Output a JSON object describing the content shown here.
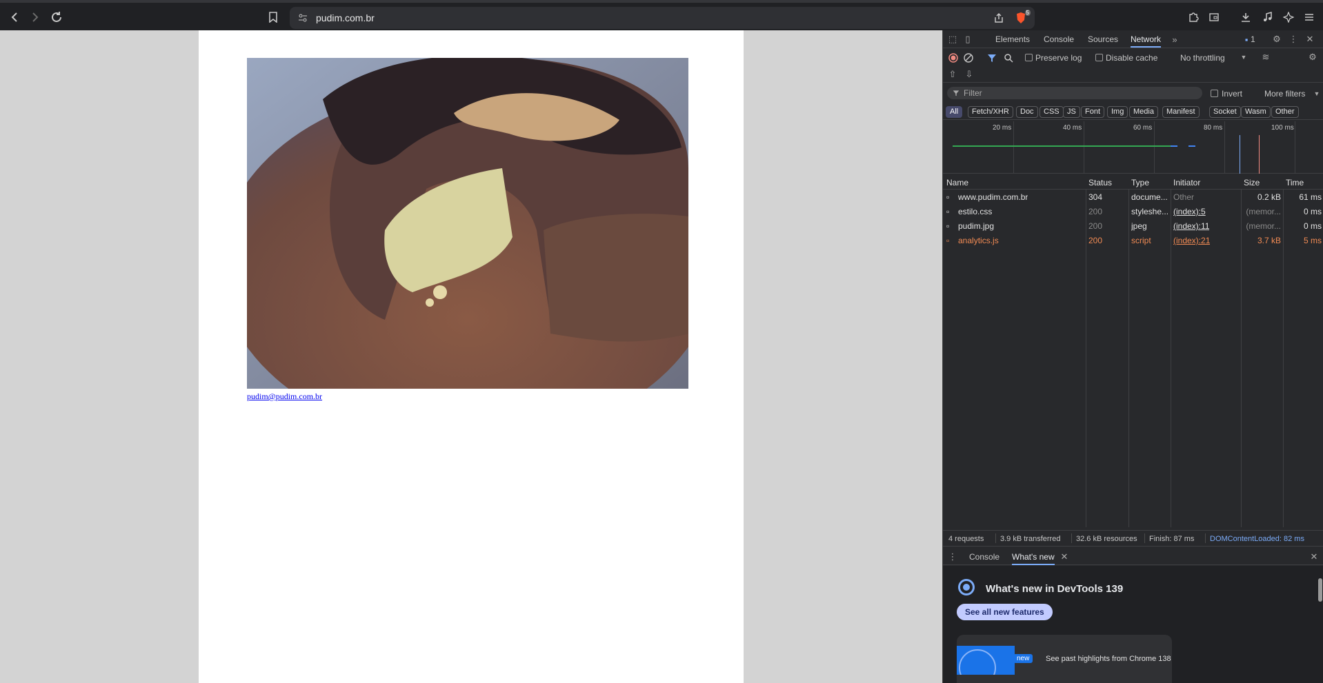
{
  "browser": {
    "url": "pudim.com.br",
    "shield_badge": "5"
  },
  "page": {
    "email": "pudim@pudim.com.br"
  },
  "devtools": {
    "tabs": [
      "Elements",
      "Console",
      "Sources",
      "Network"
    ],
    "active_tab": "Network",
    "issues_count": "1",
    "toolbar": {
      "preserve_log": "Preserve log",
      "disable_cache": "Disable cache",
      "throttling": "No throttling"
    },
    "filter": {
      "placeholder": "Filter",
      "invert": "Invert",
      "more_filters": "More filters"
    },
    "type_chips": [
      "All",
      "Fetch/XHR",
      "Doc",
      "CSS",
      "JS",
      "Font",
      "Img",
      "Media",
      "Manifest",
      "Socket",
      "Wasm",
      "Other"
    ],
    "timeline_ticks": [
      "20 ms",
      "40 ms",
      "60 ms",
      "80 ms",
      "100 ms"
    ],
    "columns": [
      "Name",
      "Status",
      "Type",
      "Initiator",
      "Size",
      "Time"
    ],
    "requests": [
      {
        "name": "www.pudim.com.br",
        "status": "304",
        "type": "docume...",
        "initiator": "Other",
        "size": "0.2 kB",
        "time": "61 ms",
        "color": "#e3e3e3"
      },
      {
        "name": "estilo.css",
        "status": "200",
        "type": "styleshe...",
        "initiator": "(index):5",
        "size": "(memor...",
        "time": "0 ms",
        "color": "#e3e3e3"
      },
      {
        "name": "pudim.jpg",
        "status": "200",
        "type": "jpeg",
        "initiator": "(index):11",
        "size": "(memor...",
        "time": "0 ms",
        "color": "#e3e3e3"
      },
      {
        "name": "analytics.js",
        "status": "200",
        "type": "script",
        "initiator": "(index):21",
        "size": "3.7 kB",
        "time": "5 ms",
        "color": "#f28b54"
      }
    ],
    "summary": {
      "requests": "4 requests",
      "transferred": "3.9 kB transferred",
      "resources": "32.6 kB resources",
      "finish": "Finish: 87 ms",
      "dcl": "DOMContentLoaded: 82 ms"
    },
    "drawer": {
      "tabs": [
        "Console",
        "What's new"
      ],
      "title": "What's new in DevTools 139",
      "button": "See all new features",
      "card_badge": "new",
      "card_text": "See past highlights from Chrome 138"
    }
  }
}
